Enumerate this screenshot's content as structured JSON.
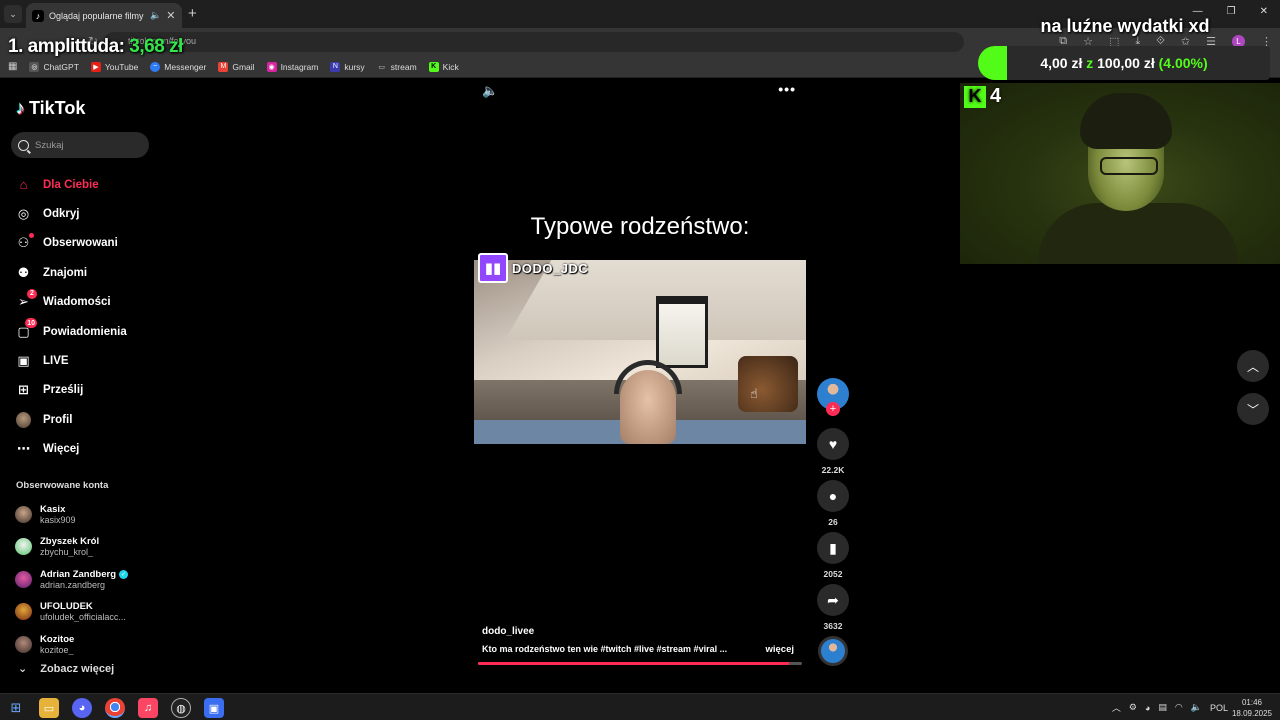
{
  "browser": {
    "tab_title": "Oglądaj popularne filmy | TikTok",
    "url": "tiktok.com/foryou",
    "bookmarks": [
      "ChatGPT",
      "YouTube",
      "Messenger",
      "Gmail",
      "Instagram",
      "kursy",
      "stream",
      "Kick"
    ]
  },
  "overlays": {
    "amplitude_label": "1. amplittuda:",
    "amplitude_value": "3,68 zł",
    "donation_title": "na luźne wydatki xd",
    "donation_current": "4,00 zł",
    "donation_sep": "z",
    "donation_goal": "100,00 zł",
    "donation_percent": "(4.00%)",
    "donation_progress": 4.0,
    "cam_counter": "4"
  },
  "sidebar": {
    "logo": "TikTok",
    "search_placeholder": "Szukaj",
    "nav": [
      {
        "label": "Dla Ciebie"
      },
      {
        "label": "Odkryj"
      },
      {
        "label": "Obserwowani"
      },
      {
        "label": "Znajomi"
      },
      {
        "label": "Wiadomości",
        "badge": "2"
      },
      {
        "label": "Powiadomienia",
        "badge": "10"
      },
      {
        "label": "LIVE"
      },
      {
        "label": "Prześlij"
      },
      {
        "label": "Profil"
      },
      {
        "label": "Więcej"
      }
    ],
    "followed_heading": "Obserwowane konta",
    "accounts": [
      {
        "name": "Kasix",
        "handle": "kasix909"
      },
      {
        "name": "Zbyszek Król",
        "handle": "zbychu_krol_"
      },
      {
        "name": "Adrian Zandberg",
        "handle": "adrian.zandberg"
      },
      {
        "name": "UFOLUDEK",
        "handle": "ufoludek_officialacc..."
      },
      {
        "name": "Kozitoe",
        "handle": "kozitoe_"
      }
    ],
    "see_more": "Zobacz więcej"
  },
  "video": {
    "caption": "Typowe rodzeństwo:",
    "twitch_name": "DODO_JDC",
    "author": "dodo_livee",
    "description": "Kto ma rodzeństwo ten wie #twitch  #live  #stream  #viral  ...",
    "more_label": "więcej",
    "progress": 0.96,
    "likes": "22.2K",
    "comments": "26",
    "saves": "2052",
    "shares": "3632"
  },
  "taskbar": {
    "language": "POL",
    "time": "01:46",
    "date": "18.09.2025"
  }
}
